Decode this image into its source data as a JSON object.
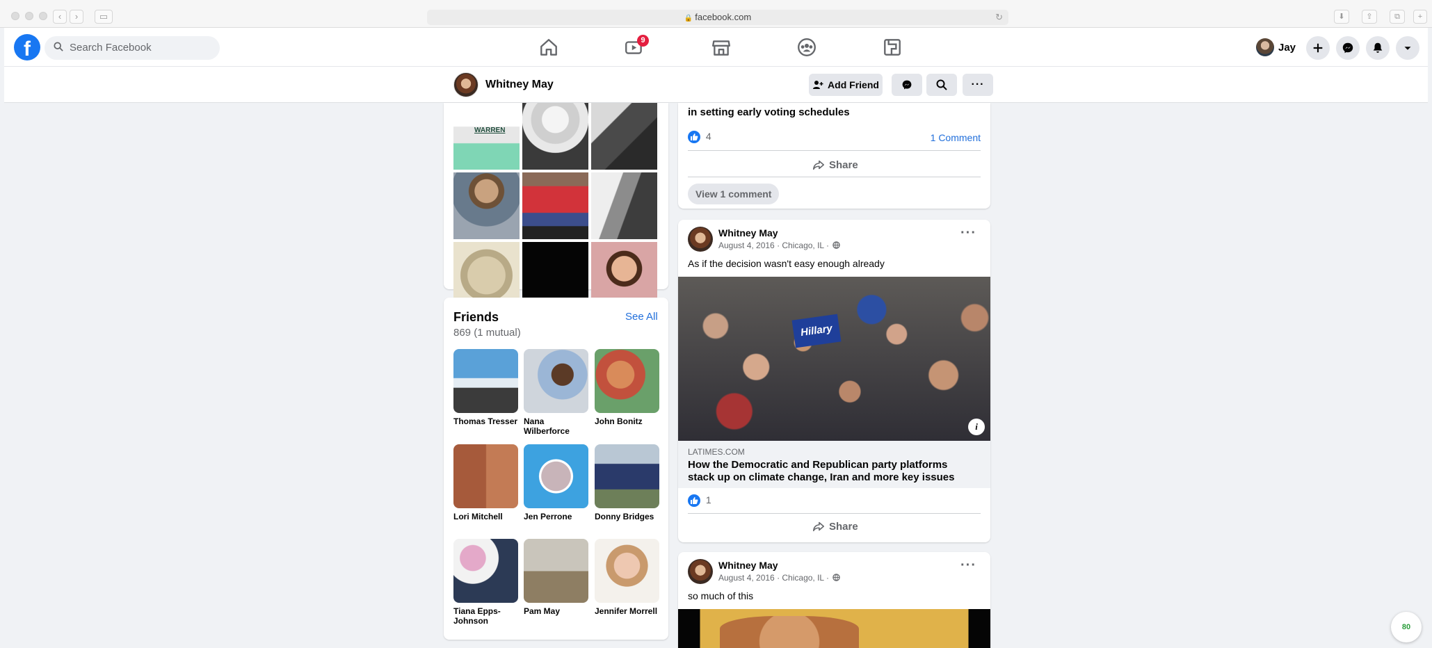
{
  "browser": {
    "url": "facebook.com"
  },
  "nav": {
    "search_placeholder": "Search Facebook",
    "watch_badge": "9",
    "user_name": "Jay",
    "tabs": [
      "home-icon",
      "watch-icon",
      "marketplace-icon",
      "groups-icon",
      "gaming-icon"
    ]
  },
  "profile_header": {
    "name": "Whitney May",
    "add_friend_label": "Add Friend"
  },
  "friends": {
    "title": "Friends",
    "count": "869 (1 mutual)",
    "see_all": "See All",
    "items": [
      {
        "name": "Thomas Tresser"
      },
      {
        "name": "Nana Wilberforce"
      },
      {
        "name": "John Bonitz"
      },
      {
        "name": "Lori Mitchell"
      },
      {
        "name": "Jen Perrone"
      },
      {
        "name": "Donny Bridges"
      },
      {
        "name": "Tiana Epps-Johnson"
      },
      {
        "name": "Pam May"
      },
      {
        "name": "Jennifer Morrell"
      }
    ]
  },
  "photos": {
    "top_caption": "WARREN"
  },
  "post0": {
    "title_tail": "in setting early voting schedules",
    "likes": "4",
    "comments": "1 Comment",
    "share": "Share",
    "view_comments": "View 1 comment"
  },
  "post1": {
    "author": "Whitney May",
    "meta": "August 4, 2016 · Chicago, IL ·",
    "text": "As if the decision wasn't easy enough already",
    "link_domain": "LATIMES.COM",
    "link_title": "How the Democratic and Republican party platforms stack up on climate change, Iran and more key issues",
    "likes": "1",
    "share": "Share"
  },
  "post2": {
    "author": "Whitney May",
    "meta": "August 4, 2016 · Chicago, IL ·",
    "text": "so much of this"
  },
  "floating_widget": {
    "count": "80"
  },
  "colors": {
    "brand": "#1877f2",
    "link": "#216fdb",
    "badge": "#e41e3f",
    "background": "#f0f2f5"
  }
}
